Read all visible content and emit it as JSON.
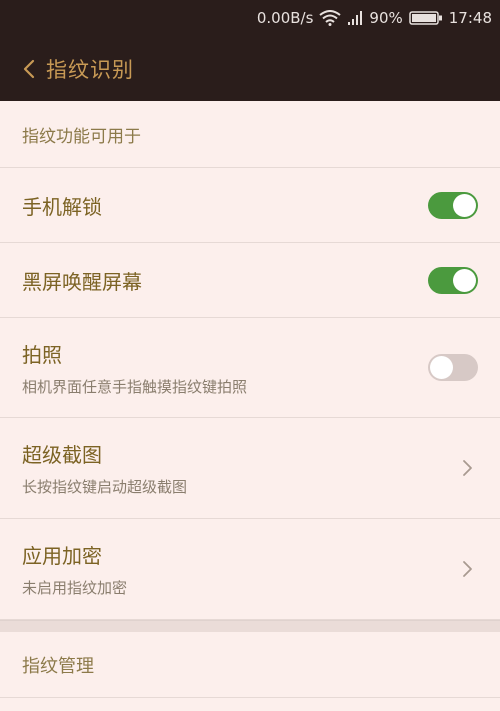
{
  "status_bar": {
    "network_speed": "0.00B/s",
    "battery_percent": "90%",
    "time": "17:48",
    "icons": [
      "wifi-icon",
      "signal-icon",
      "battery-icon"
    ]
  },
  "app_bar": {
    "title": "指纹识别",
    "back_icon": "back-arrow-icon",
    "text_color": "#c89a55",
    "background": "#2a1d1b"
  },
  "section1": {
    "header": "指纹功能可用于",
    "items": [
      {
        "title": "手机解锁",
        "control": "toggle",
        "on": true
      },
      {
        "title": "黑屏唤醒屏幕",
        "control": "toggle",
        "on": true
      },
      {
        "title": "拍照",
        "subtitle": "相机界面任意手指触摸指纹键拍照",
        "control": "toggle",
        "on": false
      },
      {
        "title": "超级截图",
        "subtitle": "长按指纹键启动超级截图",
        "control": "chevron"
      },
      {
        "title": "应用加密",
        "subtitle": "未启用指纹加密",
        "control": "chevron"
      }
    ]
  },
  "section2": {
    "header": "指纹管理"
  },
  "colors": {
    "background": "#fcefec",
    "toggle_on": "#4b9a3e",
    "toggle_off": "#d7c9c6",
    "item_title": "#7c6324",
    "item_subtitle": "#8a7e6e"
  }
}
